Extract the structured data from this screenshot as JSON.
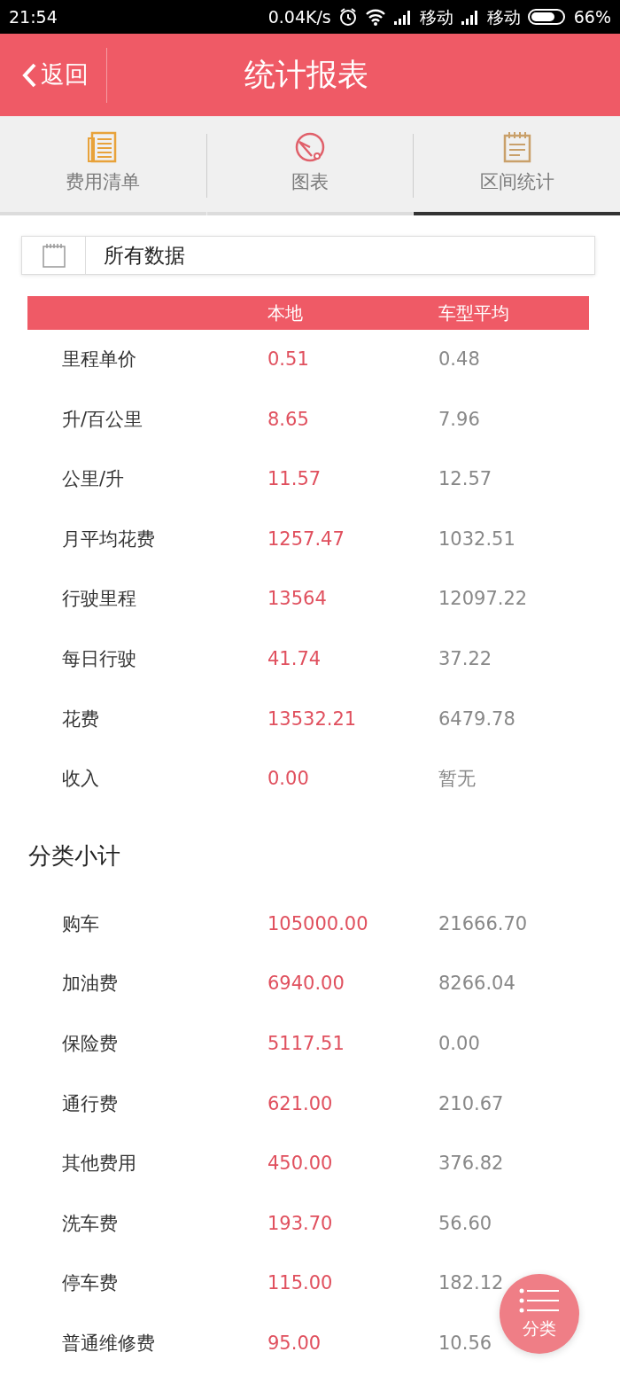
{
  "status_bar": {
    "time": "21:54",
    "speed": "0.04K/s",
    "carriers": [
      "移动",
      "移动"
    ],
    "battery": "66%"
  },
  "header": {
    "back": "返回",
    "title": "统计报表"
  },
  "tabs": [
    {
      "label": "费用清单",
      "selected": false
    },
    {
      "label": "图表",
      "selected": false
    },
    {
      "label": "区间统计",
      "selected": true
    }
  ],
  "date_filter": {
    "value": "所有数据"
  },
  "table": {
    "columns": [
      "本地",
      "车型平均"
    ],
    "rows": [
      {
        "label": "里程单价",
        "local": "0.51",
        "average": "0.48"
      },
      {
        "label": "升/百公里",
        "local": "8.65",
        "average": "7.96"
      },
      {
        "label": "公里/升",
        "local": "11.57",
        "average": "12.57"
      },
      {
        "label": "月平均花费",
        "local": "1257.47",
        "average": "1032.51"
      },
      {
        "label": "行驶里程",
        "local": "13564",
        "average": "12097.22"
      },
      {
        "label": "每日行驶",
        "local": "41.74",
        "average": "37.22"
      },
      {
        "label": "花费",
        "local": "13532.21",
        "average": "6479.78"
      },
      {
        "label": "收入",
        "local": "0.00",
        "average": "暂无"
      }
    ]
  },
  "subtotals": {
    "title": "分类小计",
    "rows": [
      {
        "label": "购车",
        "local": "105000.00",
        "average": "21666.70"
      },
      {
        "label": "加油费",
        "local": "6940.00",
        "average": "8266.04"
      },
      {
        "label": "保险费",
        "local": "5117.51",
        "average": "0.00"
      },
      {
        "label": "通行费",
        "local": "621.00",
        "average": "210.67"
      },
      {
        "label": "其他费用",
        "local": "450.00",
        "average": "376.82"
      },
      {
        "label": "洗车费",
        "local": "193.70",
        "average": "56.60"
      },
      {
        "label": "停车费",
        "local": "115.00",
        "average": "182.12"
      },
      {
        "label": "普通维修费",
        "local": "95.00",
        "average": "10.56"
      }
    ]
  },
  "fab": {
    "label": "分类"
  }
}
